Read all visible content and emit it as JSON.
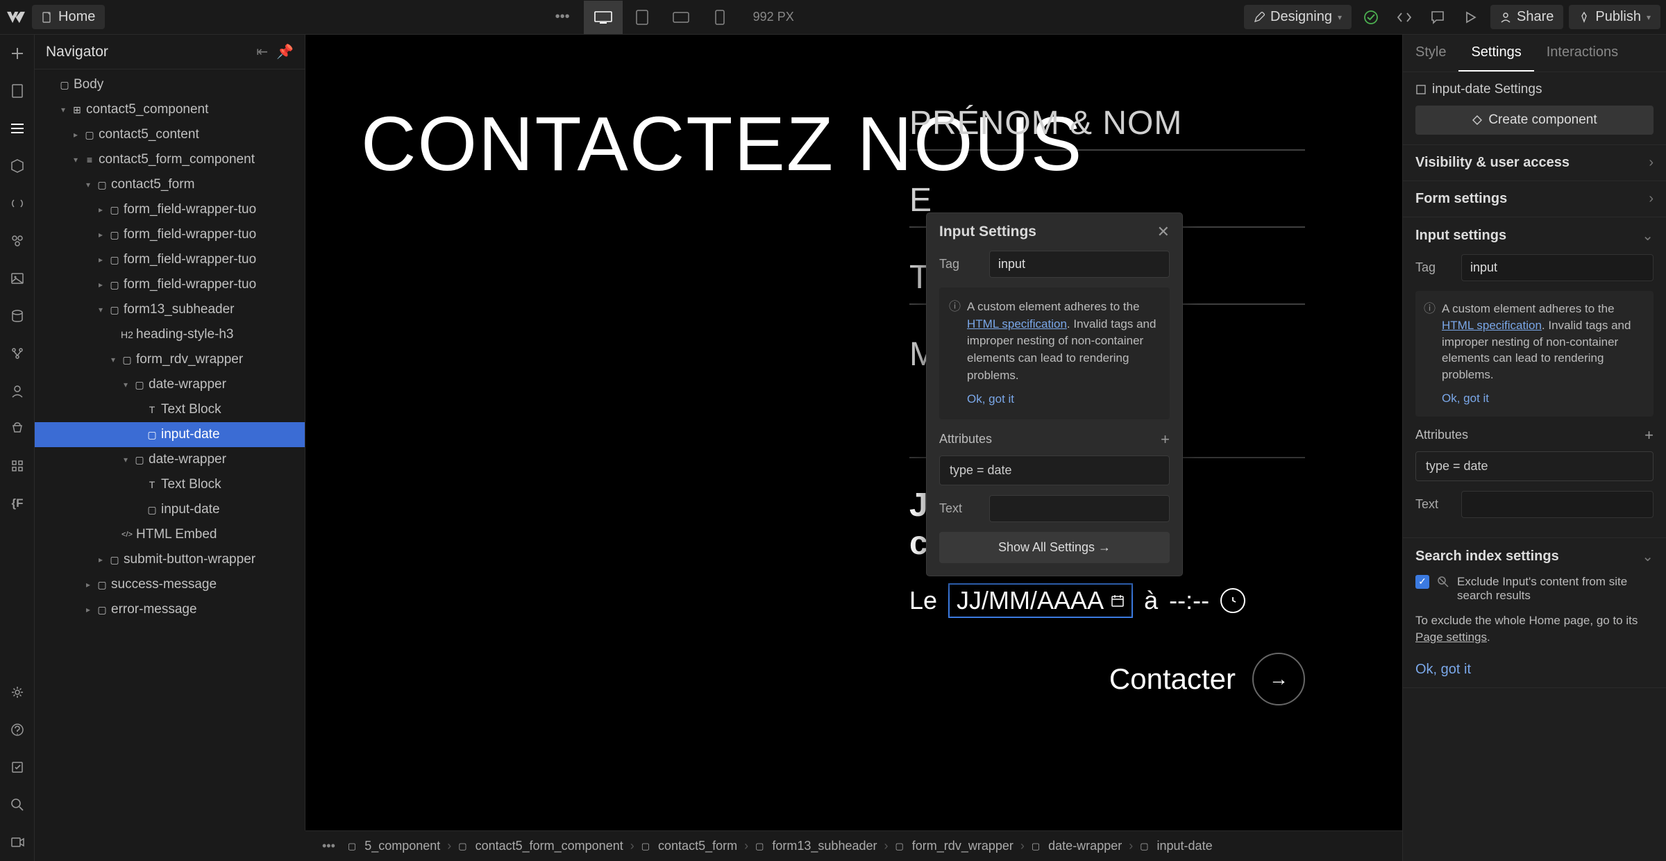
{
  "topbar": {
    "home": "Home",
    "px": "992 PX",
    "designing": "Designing",
    "share": "Share",
    "publish": "Publish"
  },
  "navigator": {
    "title": "Navigator",
    "tree": [
      {
        "indent": 0,
        "arrow": "",
        "icon": "▢",
        "label": "Body"
      },
      {
        "indent": 1,
        "arrow": "▾",
        "icon": "⊞",
        "label": "contact5_component"
      },
      {
        "indent": 2,
        "arrow": "▸",
        "icon": "▢",
        "label": "contact5_content"
      },
      {
        "indent": 2,
        "arrow": "▾",
        "icon": "≡",
        "label": "contact5_form_component"
      },
      {
        "indent": 3,
        "arrow": "▾",
        "icon": "▢",
        "label": "contact5_form"
      },
      {
        "indent": 4,
        "arrow": "▸",
        "icon": "▢",
        "label": "form_field-wrapper-tuo"
      },
      {
        "indent": 4,
        "arrow": "▸",
        "icon": "▢",
        "label": "form_field-wrapper-tuo"
      },
      {
        "indent": 4,
        "arrow": "▸",
        "icon": "▢",
        "label": "form_field-wrapper-tuo"
      },
      {
        "indent": 4,
        "arrow": "▸",
        "icon": "▢",
        "label": "form_field-wrapper-tuo"
      },
      {
        "indent": 4,
        "arrow": "▾",
        "icon": "▢",
        "label": "form13_subheader"
      },
      {
        "indent": 5,
        "arrow": "",
        "icon": "H2",
        "label": "heading-style-h3"
      },
      {
        "indent": 5,
        "arrow": "▾",
        "icon": "▢",
        "label": "form_rdv_wrapper"
      },
      {
        "indent": 6,
        "arrow": "▾",
        "icon": "▢",
        "label": "date-wrapper"
      },
      {
        "indent": 7,
        "arrow": "",
        "icon": "T",
        "label": "Text Block"
      },
      {
        "indent": 7,
        "arrow": "",
        "icon": "▢",
        "label": "input-date",
        "selected": true
      },
      {
        "indent": 6,
        "arrow": "▾",
        "icon": "▢",
        "label": "date-wrapper"
      },
      {
        "indent": 7,
        "arrow": "",
        "icon": "T",
        "label": "Text Block"
      },
      {
        "indent": 7,
        "arrow": "",
        "icon": "▢",
        "label": "input-date"
      },
      {
        "indent": 5,
        "arrow": "",
        "icon": "</>",
        "label": "HTML Embed"
      },
      {
        "indent": 4,
        "arrow": "▸",
        "icon": "▢",
        "label": "submit-button-wrapper"
      },
      {
        "indent": 3,
        "arrow": "▸",
        "icon": "▢",
        "label": "success-message"
      },
      {
        "indent": 3,
        "arrow": "▸",
        "icon": "▢",
        "label": "error-message"
      }
    ]
  },
  "canvas": {
    "heading": "CONTACTEZ NOUS",
    "field1": "PRÉNOM & NOM",
    "field2": "E",
    "field3": "T",
    "msg": "M",
    "contact_line": "Je souhaite être contacté",
    "le": "Le",
    "date_placeholder": "JJ/MM/AAAA",
    "a": "à",
    "time_placeholder": "--:--",
    "contacter": "Contacter"
  },
  "popover": {
    "title": "Input Settings",
    "tag_label": "Tag",
    "tag_value": "input",
    "note_prefix": "A custom element adheres to the ",
    "note_link": "HTML specification",
    "note_suffix": ". Invalid tags and improper nesting of non-container elements can lead to rendering problems.",
    "ok": "Ok, got it",
    "attributes": "Attributes",
    "attr_value": "type = date",
    "text_label": "Text",
    "show_all": "Show All Settings  →"
  },
  "right": {
    "tabs": [
      "Style",
      "Settings",
      "Interactions"
    ],
    "element_label": "input-date Settings",
    "create_component": "Create component",
    "visibility": "Visibility & user access",
    "form_settings": "Form settings",
    "input_settings": "Input settings",
    "tag_label": "Tag",
    "tag_value": "input",
    "note_prefix": "A custom element adheres to the ",
    "note_link": "HTML specification",
    "note_suffix": ". Invalid tags and improper nesting of non-container elements can lead to rendering problems.",
    "ok": "Ok, got it",
    "attributes": "Attributes",
    "attr_value": "type = date",
    "text_label": "Text",
    "search_index": "Search index settings",
    "exclude": "Exclude Input's content from site search results",
    "exclude_note_pre": "To exclude the whole Home page, go to its ",
    "exclude_note_link": "Page settings",
    "exclude_note_post": ".",
    "ok2": "Ok, got it"
  },
  "breadcrumb": [
    "5_component",
    "contact5_form_component",
    "contact5_form",
    "form13_subheader",
    "form_rdv_wrapper",
    "date-wrapper",
    "input-date"
  ]
}
